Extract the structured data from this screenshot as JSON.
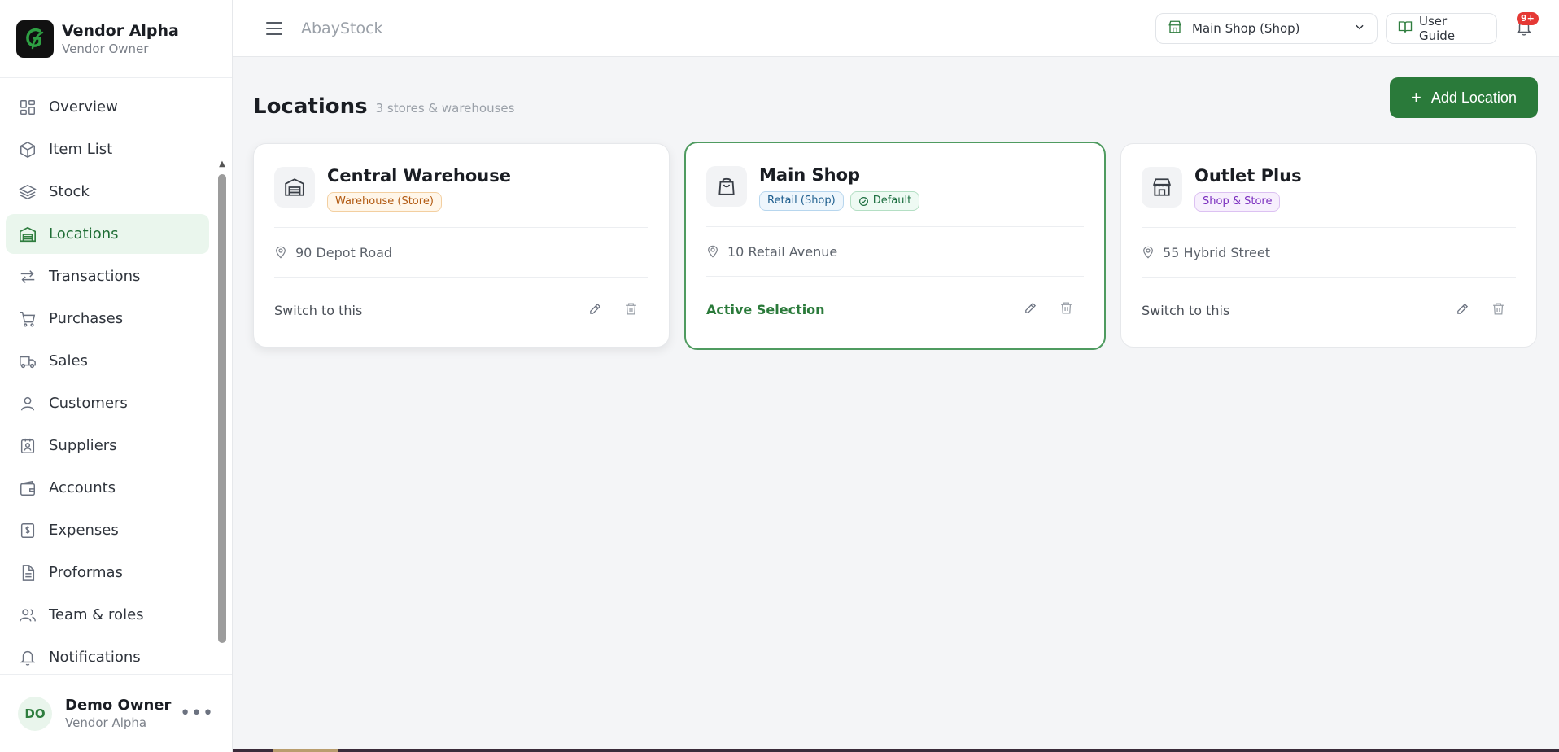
{
  "brand": {
    "name": "Vendor Alpha",
    "role": "Vendor Owner"
  },
  "sidebar": {
    "items": [
      {
        "label": "Overview",
        "icon": "grid-icon",
        "active": false
      },
      {
        "label": "Item List",
        "icon": "box-icon",
        "active": false
      },
      {
        "label": "Stock",
        "icon": "layers-icon",
        "active": false
      },
      {
        "label": "Locations",
        "icon": "warehouse-icon",
        "active": true
      },
      {
        "label": "Transactions",
        "icon": "arrows-icon",
        "active": false
      },
      {
        "label": "Purchases",
        "icon": "cart-icon",
        "active": false
      },
      {
        "label": "Sales",
        "icon": "truck-icon",
        "active": false
      },
      {
        "label": "Customers",
        "icon": "user-icon",
        "active": false
      },
      {
        "label": "Suppliers",
        "icon": "badge-icon",
        "active": false
      },
      {
        "label": "Accounts",
        "icon": "wallet-icon",
        "active": false
      },
      {
        "label": "Expenses",
        "icon": "receipt-dollar-icon",
        "active": false
      },
      {
        "label": "Proformas",
        "icon": "document-icon",
        "active": false
      },
      {
        "label": "Team & roles",
        "icon": "users-icon",
        "active": false
      },
      {
        "label": "Notifications",
        "icon": "bell-icon",
        "active": false
      }
    ]
  },
  "user": {
    "initials": "DO",
    "name": "Demo Owner",
    "org": "Vendor Alpha",
    "menu": "•••"
  },
  "topbar": {
    "app_name": "AbayStock",
    "location_select": "Main Shop (Shop)",
    "guide_label": "User Guide",
    "notif_badge": "9+"
  },
  "page": {
    "title": "Locations",
    "subtitle": "3 stores & warehouses",
    "add_label": "Add Location"
  },
  "colors": {
    "accent": "#2a7a3a",
    "active_bg": "#eaf6ed",
    "badge": "#e53935"
  },
  "locations": [
    {
      "name": "Central Warehouse",
      "icon": "warehouse-icon",
      "tags": [
        {
          "label": "Warehouse (Store)",
          "style": "orange"
        }
      ],
      "address": "90 Depot Road",
      "action": "Switch to this",
      "selected": false
    },
    {
      "name": "Main Shop",
      "icon": "shopping-bag-icon",
      "tags": [
        {
          "label": "Retail (Shop)",
          "style": "blue"
        },
        {
          "label": "Default",
          "style": "green"
        }
      ],
      "address": "10 Retail Avenue",
      "action": "Active Selection",
      "selected": true
    },
    {
      "name": "Outlet Plus",
      "icon": "store-icon",
      "tags": [
        {
          "label": "Shop & Store",
          "style": "purple"
        }
      ],
      "address": "55 Hybrid Street",
      "action": "Switch to this",
      "selected": false
    }
  ]
}
